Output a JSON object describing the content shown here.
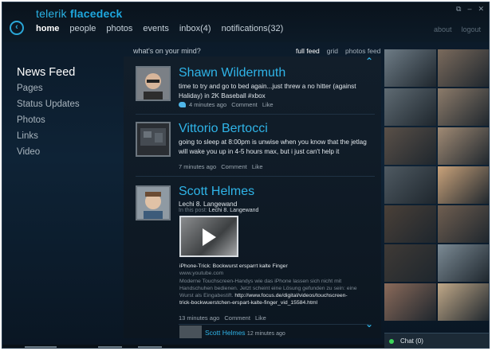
{
  "app": {
    "brand_prefix": "telerik",
    "brand_name": "flacedeck",
    "window_controls": [
      "⧉",
      "–",
      "✕"
    ]
  },
  "nav": {
    "back_glyph": "‹",
    "items": [
      "home",
      "people",
      "photos",
      "events",
      "inbox(4)",
      "notifications(32)"
    ],
    "active_index": 0,
    "right": [
      "about",
      "logout"
    ]
  },
  "sidebar": {
    "items": [
      "News Feed",
      "Pages",
      "Status Updates",
      "Photos",
      "Links",
      "Video"
    ],
    "active_index": 0
  },
  "feed": {
    "prompt": "what's on your mind?",
    "tabs": [
      "full feed",
      "grid",
      "photos feed"
    ],
    "active_tab": 0,
    "scroll_up_glyph": "⌃",
    "scroll_down_glyph": "⌄",
    "posts": [
      {
        "author": "Shawn Wildermuth",
        "text": "time to try and go to bed again...just threw a no hitter (against Haliday) in 2K Baseball #xbox",
        "time": "4 minutes ago",
        "actions": [
          "Comment",
          "Like"
        ]
      },
      {
        "author": "Vittorio Bertocci",
        "text": "going to sleep at 8:00pm is unwise when you know that the jetlag will wake you up in 4-5 hours max, but i just can't help it",
        "time": "7 minutes ago",
        "actions": [
          "Comment",
          "Like"
        ]
      },
      {
        "author": "Scott Helmes",
        "text": "Lechi 8. Langewand",
        "in_post_prefix": "In this post:",
        "in_post_name": "Lechi 8. Langewand",
        "video_title": "iPhone-Trick: Bockwurst ersparrt kalte Finger",
        "video_source": "www.youtube.com",
        "video_desc": "Moderne Touchscreen-Handys wie das iPhone lassen sich nicht mit Handschuhen bedienen. Jetzt scheint eine Lösung gefunden zu sein: eine Wurst als Eingabestift.",
        "video_link": "http://www.focus.de/digital/videos/touchscreen-trick-bockwuerstchen-erspart-kalte-finger_vid_15584.html",
        "time": "13 minutes ago",
        "actions": [
          "Comment",
          "Like"
        ]
      }
    ],
    "comment": {
      "author": "Scott Helmes",
      "time": "12 minutes ago"
    }
  },
  "photos_panel": {
    "tiles": [
      "#6e7c86",
      "#7a6a5c",
      "#5f6b73",
      "#8c7b6a",
      "#5a5048",
      "#a08a74",
      "#4f5a62",
      "#c9a27a",
      "#4a4038",
      "#6f5e50",
      "#3f3a36",
      "#7b8a94",
      "#8a6a5a",
      "#c0a888"
    ]
  },
  "chat": {
    "label": "Chat (0)",
    "status_color": "#3cd65a"
  }
}
